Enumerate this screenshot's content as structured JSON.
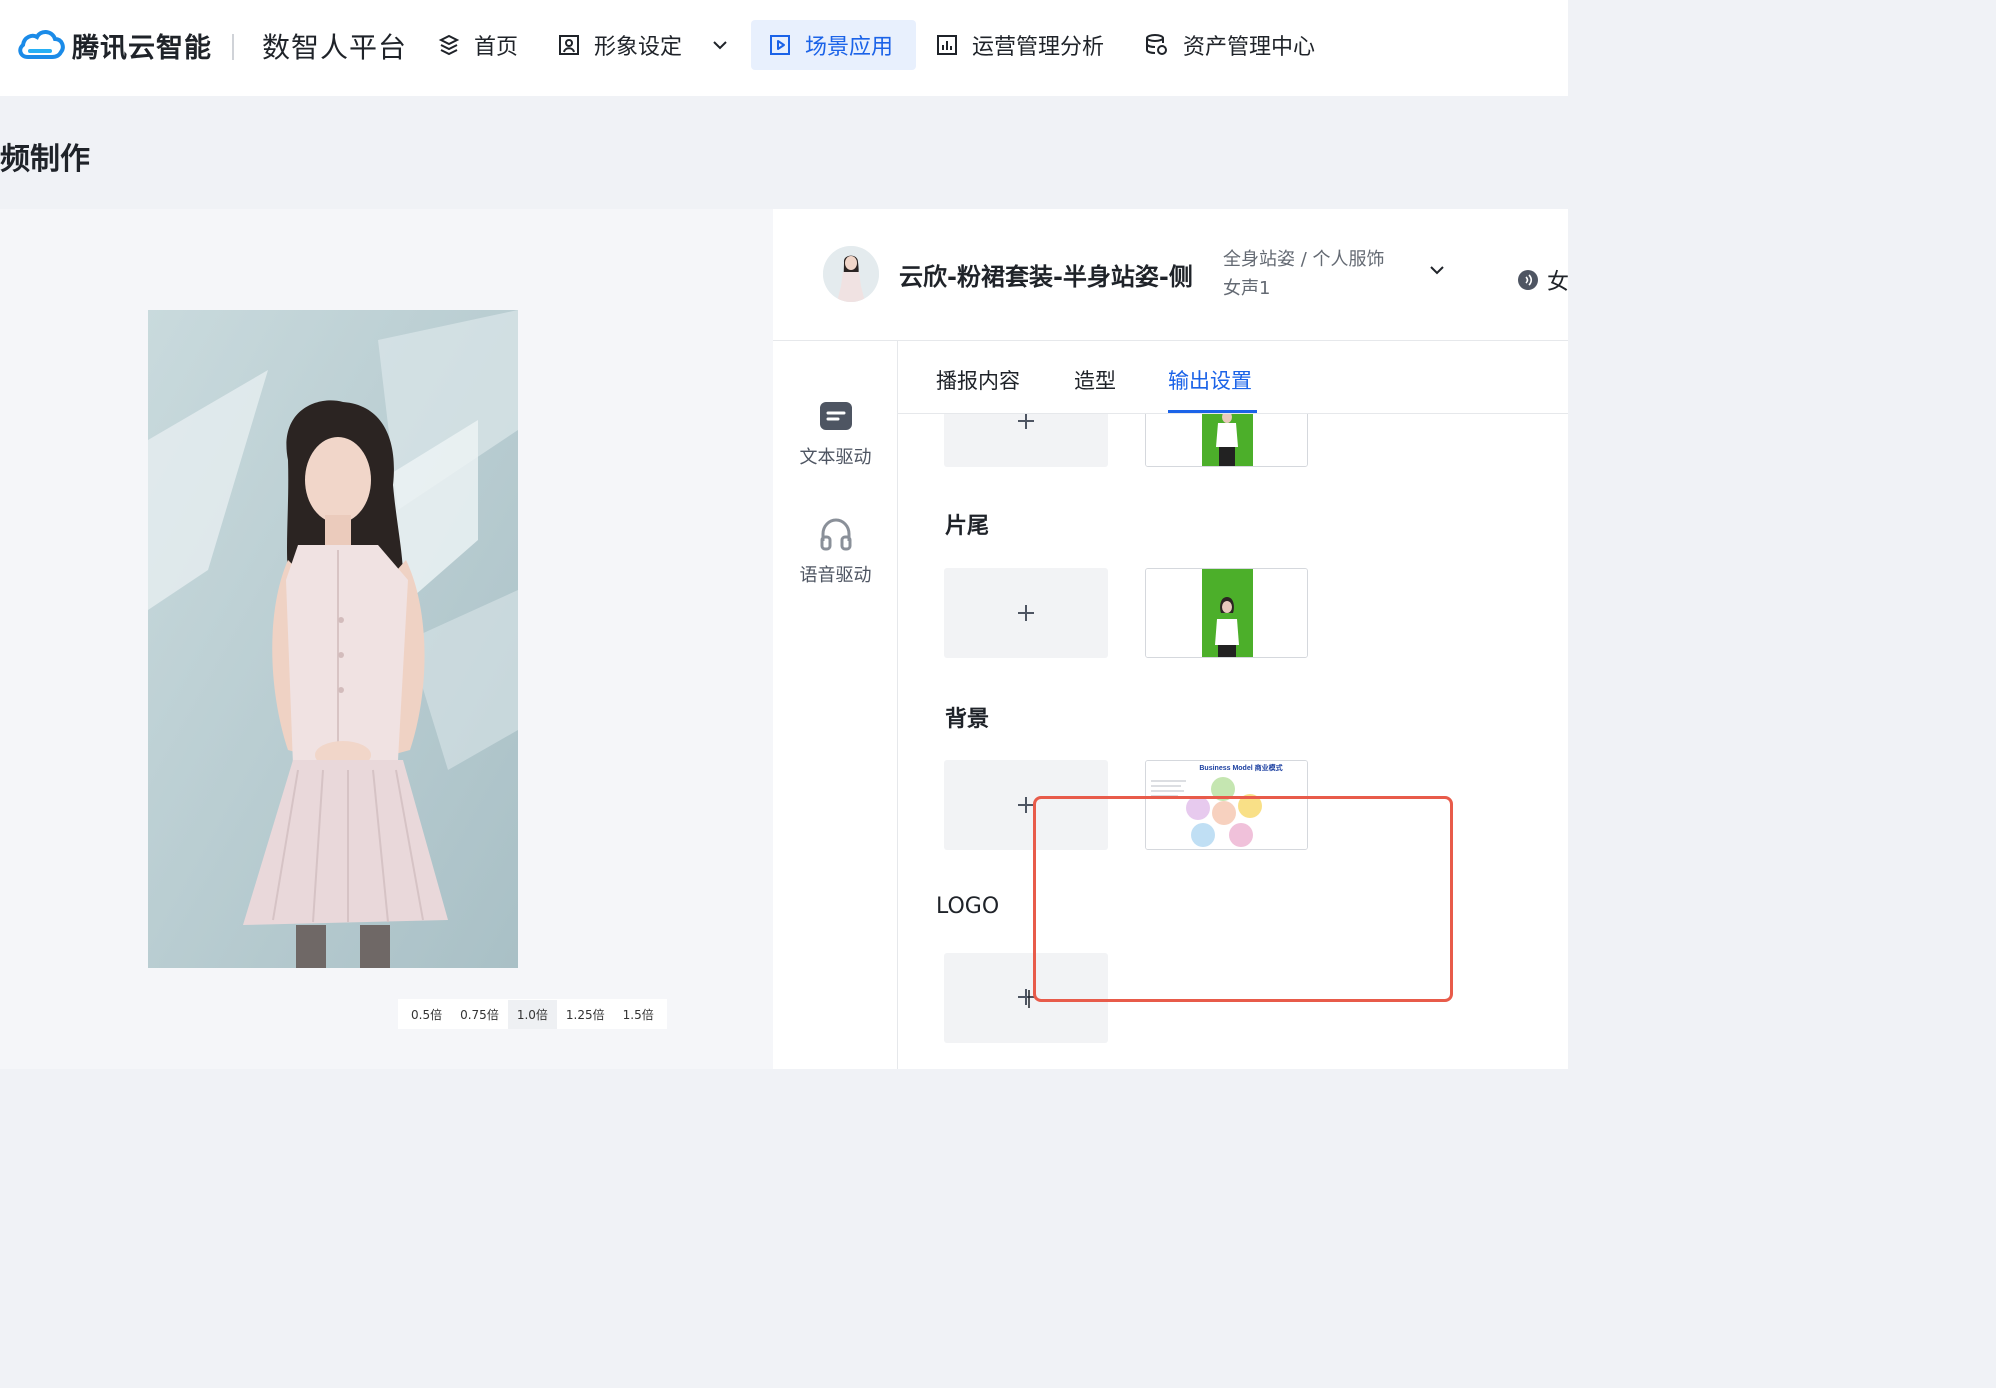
{
  "header": {
    "logo_text": "腾讯云智能",
    "platform_name": "数智人平台",
    "nav": [
      {
        "label": "首页",
        "icon": "layers-icon"
      },
      {
        "label": "形象设定",
        "icon": "portrait-icon"
      },
      {
        "label": "场景应用",
        "icon": "play-icon",
        "active": true
      },
      {
        "label": "运营管理分析",
        "icon": "bar-chart-icon"
      },
      {
        "label": "资产管理中心",
        "icon": "database-icon"
      }
    ]
  },
  "page": {
    "title": "频制作"
  },
  "preview": {
    "speeds": [
      "0.5倍",
      "0.75倍",
      "1.0倍",
      "1.25倍",
      "1.5倍"
    ],
    "active_speed": "1.0倍"
  },
  "avatar": {
    "name": "云欣-粉裙套装-半身站姿-侧",
    "meta_line1": "全身站姿 / 个人服饰",
    "meta_line2": "女声1",
    "voice_label": "女"
  },
  "side_tabs": [
    {
      "label": "文本驱动",
      "icon": "text-drive-icon"
    },
    {
      "label": "语音驱动",
      "icon": "headphones-icon"
    }
  ],
  "tabs": [
    {
      "label": "播报内容"
    },
    {
      "label": "造型"
    },
    {
      "label": "输出设置",
      "active": true
    }
  ],
  "sections": {
    "outro": "片尾",
    "background": "背景",
    "logo": "LOGO"
  },
  "thumbnail_text": {
    "title": "Business Model 商业模式"
  },
  "colors": {
    "accent": "#1b63e8",
    "highlight_border": "#e85b4a",
    "green_screen": "#4caf2a"
  }
}
